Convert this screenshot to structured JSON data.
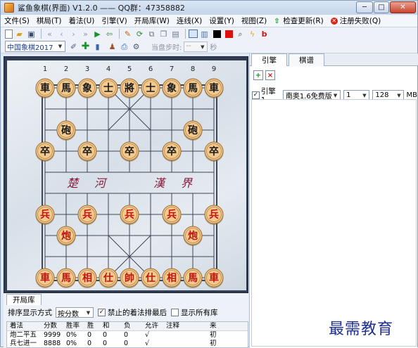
{
  "window": {
    "title": "鲨鱼象棋(界面) V1.2.0 —— QQ群：47358882",
    "minimize_glyph": "─",
    "maximize_glyph": "□",
    "close_glyph": "✕"
  },
  "menubar": {
    "items": [
      "文件(S)",
      "棋局(T)",
      "着法(U)",
      "引擎(V)",
      "开局库(W)",
      "连线(X)",
      "设置(Y)",
      "视图(Z)"
    ],
    "update_label": "检查更新(R)",
    "register_label": "注册失败(Q)"
  },
  "toolbar2": {
    "variant": "中国象棋2017",
    "think_label": "当盘步时:",
    "think_value": "--",
    "seconds_label": "秒"
  },
  "board": {
    "file_numbers": [
      "1",
      "2",
      "3",
      "4",
      "5",
      "6",
      "7",
      "8",
      "9"
    ],
    "river_chars": [
      "楚",
      "河",
      "漢",
      "界"
    ],
    "black_pieces": [
      {
        "char": "車",
        "file": 0,
        "rank": 0
      },
      {
        "char": "馬",
        "file": 1,
        "rank": 0
      },
      {
        "char": "象",
        "file": 2,
        "rank": 0
      },
      {
        "char": "士",
        "file": 3,
        "rank": 0
      },
      {
        "char": "將",
        "file": 4,
        "rank": 0
      },
      {
        "char": "士",
        "file": 5,
        "rank": 0
      },
      {
        "char": "象",
        "file": 6,
        "rank": 0
      },
      {
        "char": "馬",
        "file": 7,
        "rank": 0
      },
      {
        "char": "車",
        "file": 8,
        "rank": 0
      },
      {
        "char": "砲",
        "file": 1,
        "rank": 2
      },
      {
        "char": "砲",
        "file": 7,
        "rank": 2
      },
      {
        "char": "卒",
        "file": 0,
        "rank": 3
      },
      {
        "char": "卒",
        "file": 2,
        "rank": 3
      },
      {
        "char": "卒",
        "file": 4,
        "rank": 3
      },
      {
        "char": "卒",
        "file": 6,
        "rank": 3
      },
      {
        "char": "卒",
        "file": 8,
        "rank": 3
      }
    ],
    "red_pieces": [
      {
        "char": "兵",
        "file": 0,
        "rank": 6
      },
      {
        "char": "兵",
        "file": 2,
        "rank": 6
      },
      {
        "char": "兵",
        "file": 4,
        "rank": 6
      },
      {
        "char": "兵",
        "file": 6,
        "rank": 6
      },
      {
        "char": "兵",
        "file": 8,
        "rank": 6
      },
      {
        "char": "炮",
        "file": 1,
        "rank": 7
      },
      {
        "char": "炮",
        "file": 7,
        "rank": 7
      },
      {
        "char": "車",
        "file": 0,
        "rank": 9
      },
      {
        "char": "馬",
        "file": 1,
        "rank": 9
      },
      {
        "char": "相",
        "file": 2,
        "rank": 9
      },
      {
        "char": "仕",
        "file": 3,
        "rank": 9
      },
      {
        "char": "帥",
        "file": 4,
        "rank": 9
      },
      {
        "char": "仕",
        "file": 5,
        "rank": 9
      },
      {
        "char": "相",
        "file": 6,
        "rank": 9
      },
      {
        "char": "馬",
        "file": 7,
        "rank": 9
      },
      {
        "char": "車",
        "file": 8,
        "rank": 9
      }
    ]
  },
  "right_panel": {
    "tabs": [
      "引擎",
      "棋谱"
    ],
    "engine_label": "引擎1",
    "engine_name": "南奥1.6免费版",
    "threads": "1",
    "hash_size": "128",
    "hash_unit": "MB"
  },
  "opening": {
    "tab": "开局库",
    "sort_label": "排序显示方式",
    "sort_value": "按分数",
    "ban_label": "禁止的着法排最后",
    "show_all_label": "显示所有库",
    "columns": [
      "着法",
      "分数",
      "胜率",
      "胜",
      "和",
      "负",
      "允许",
      "注释",
      "来"
    ],
    "rows": [
      [
        "炮二平五",
        "9999",
        "0%",
        "0",
        "0",
        "0",
        "√",
        "",
        "初"
      ],
      [
        "兵七进一",
        "8888",
        "0%",
        "0",
        "0",
        "0",
        "√",
        "",
        "初"
      ]
    ]
  },
  "watermark": "最需教育",
  "colors": {
    "black_piece_text": "#1a1a1a",
    "red_piece_text": "#c0160e",
    "piece_fill": "#f2c98e",
    "board_frame": "#2f3c52",
    "accent_blue": "#1f2f8f"
  }
}
